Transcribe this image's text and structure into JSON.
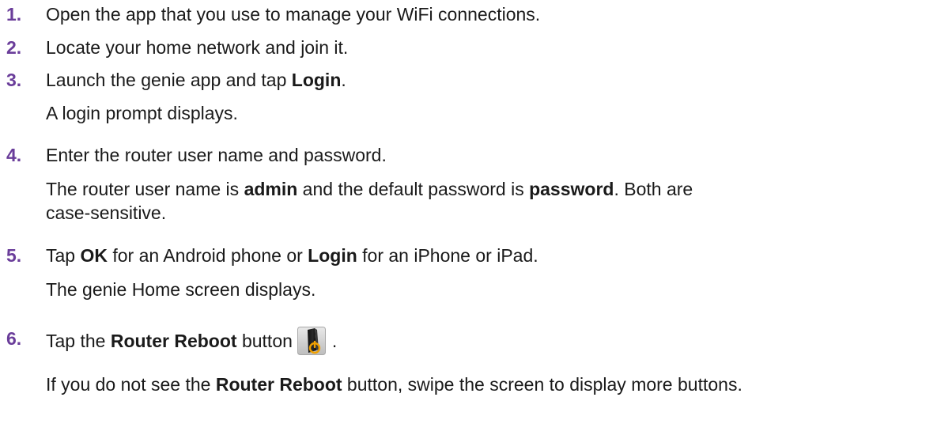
{
  "steps": [
    {
      "number": "1.",
      "text": "Open the app that you use to manage your WiFi connections."
    },
    {
      "number": "2.",
      "text": "Locate your home network and join it."
    },
    {
      "number": "3.",
      "pre": "Launch the genie app and tap ",
      "bold": "Login",
      "post": ".",
      "result": "A login prompt displays."
    },
    {
      "number": "4.",
      "text": "Enter the router user name and password.",
      "note_pre": "The router user name is ",
      "note_bold1": "admin",
      "note_mid": " and the default password is ",
      "note_bold2": "password",
      "note_post": ". Both are",
      "note_line2": "case-sensitive."
    },
    {
      "number": "5.",
      "pre": "Tap ",
      "bold1": "OK",
      "mid": " for an Android phone or ",
      "bold2": "Login",
      "post": " for an iPhone or iPad.",
      "result": "The genie Home screen displays."
    },
    {
      "number": "6.",
      "pre": "Tap the ",
      "bold": "Router Reboot",
      "mid": " button",
      "post": ".",
      "icon": "router-reboot-icon",
      "note_pre": "If you do not see the ",
      "note_bold": "Router Reboot",
      "note_post": " button, swipe the screen to display more buttons."
    }
  ],
  "colors": {
    "step_number": "#6a3d9a",
    "text": "#1a1a1a"
  }
}
